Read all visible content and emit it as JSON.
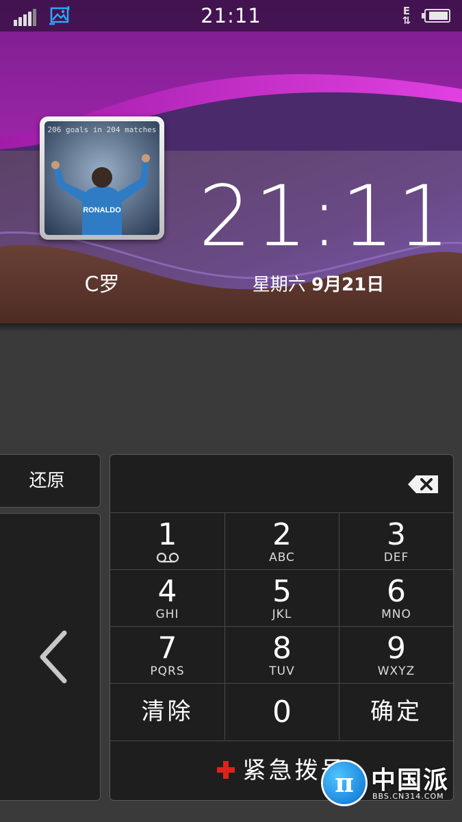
{
  "status_bar": {
    "time": "21:11",
    "network_type": "E",
    "signal_level": 4,
    "battery_level": 0.9
  },
  "lock_screen": {
    "contact_name": "C罗",
    "photo_caption": "206 goals in 204 matches",
    "jersey_text": "RONALDO",
    "clock": "21:11",
    "date_weekday": "星期六",
    "date_month_day": "9月21日"
  },
  "left_panel": {
    "restore_label": "还原"
  },
  "keypad": {
    "keys": [
      {
        "num": "1",
        "sub": "voicemail-icon"
      },
      {
        "num": "2",
        "sub": "ABC"
      },
      {
        "num": "3",
        "sub": "DEF"
      },
      {
        "num": "4",
        "sub": "GHI"
      },
      {
        "num": "5",
        "sub": "JKL"
      },
      {
        "num": "6",
        "sub": "MNO"
      },
      {
        "num": "7",
        "sub": "PQRS"
      },
      {
        "num": "8",
        "sub": "TUV"
      },
      {
        "num": "9",
        "sub": "WXYZ"
      },
      {
        "num": "清除",
        "sub": ""
      },
      {
        "num": "0",
        "sub": ""
      },
      {
        "num": "确定",
        "sub": ""
      }
    ],
    "clear_label": "清除",
    "confirm_label": "确定",
    "emergency_label": "紧急拨号"
  },
  "watermark": {
    "brand": "中国派",
    "url": "BBS.CN314.COM"
  },
  "colors": {
    "emergency_cross": "#e0211b",
    "keypad_bg": "#1e1e1e",
    "body_bg": "#3a3a3a"
  }
}
